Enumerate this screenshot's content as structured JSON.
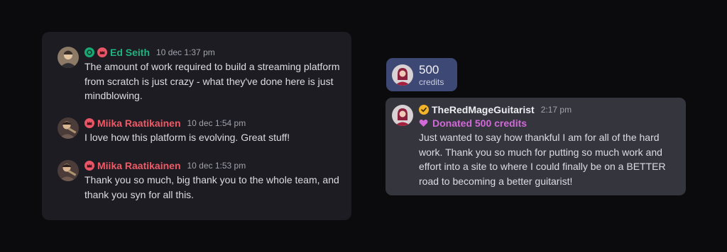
{
  "chat": {
    "messages": [
      {
        "username": "Ed Seith",
        "timestamp": "10 dec 1:37 pm",
        "text": "The amount of work required to build a streaming platform from scratch is just crazy - what they've done here is just mindblowing.",
        "badges": [
          "subscriber-badge",
          "crown-badge"
        ],
        "name_color": "#21b380"
      },
      {
        "username": "Miika Raatikainen",
        "timestamp": "10 dec 1:54 pm",
        "text": "I love how this platform is evolving. Great stuff!",
        "badges": [
          "crown-badge"
        ],
        "name_color": "#f05a67"
      },
      {
        "username": "Miika Raatikainen",
        "timestamp": "10 dec 1:53 pm",
        "text": "Thank you so much, big thank you to the whole team, and thank you syn for all this.",
        "badges": [
          "crown-badge"
        ],
        "name_color": "#f05a67"
      }
    ]
  },
  "credits_pill": {
    "amount": "500",
    "unit": "credits",
    "background": "#3e4874"
  },
  "donation": {
    "username": "TheRedMageGuitarist",
    "timestamp": "2:17 pm",
    "label": "Donated 500 credits",
    "text": "Just wanted to say how thankful I am for all of the hard work. Thank you so much for putting so much work and effort into a site to where I could finally be on a BETTER road to becoming a better guitarist!",
    "badge_icon": "verified-check-icon",
    "label_icon": "heart-icon",
    "accent": "#d16ad8"
  }
}
